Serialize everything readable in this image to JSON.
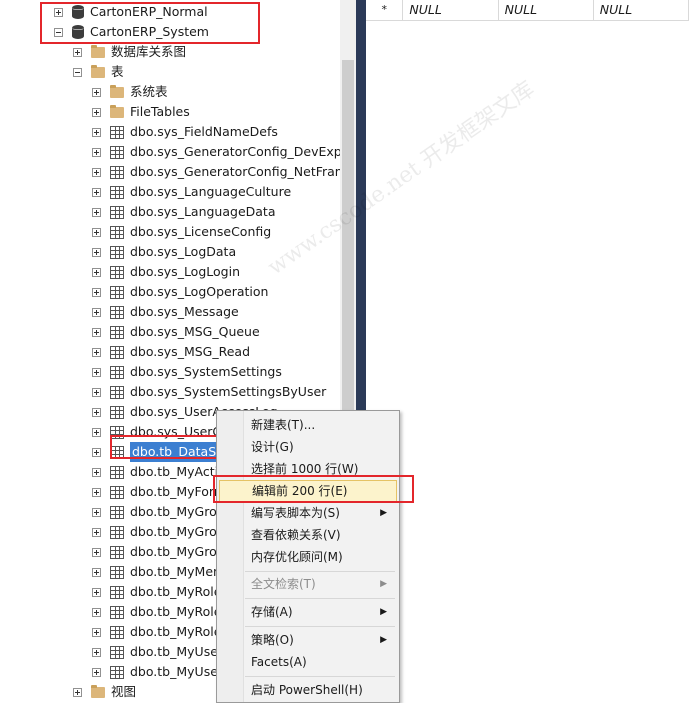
{
  "tree": {
    "databases": [
      {
        "label": "CartonERP_Normal"
      },
      {
        "label": "CartonERP_System"
      }
    ],
    "folders": {
      "diagrams": "数据库关系图",
      "tables": "表",
      "system_tables": "系统表",
      "filetables": "FileTables",
      "views": "视图"
    },
    "tables": [
      "dbo.sys_FieldNameDefs",
      "dbo.sys_GeneratorConfig_DevExpres",
      "dbo.sys_GeneratorConfig_NetFramew",
      "dbo.sys_LanguageCulture",
      "dbo.sys_LanguageData",
      "dbo.sys_LicenseConfig",
      "dbo.sys_LogData",
      "dbo.sys_LogLogin",
      "dbo.sys_LogOperation",
      "dbo.sys_Message",
      "dbo.sys_MSG_Queue",
      "dbo.sys_MSG_Read",
      "dbo.sys_SystemSettings",
      "dbo.sys_SystemSettingsByUser",
      "dbo.sys_UserAccessLog",
      "dbo.sys_UserC",
      "dbo.tb_DataSet",
      "dbo.tb_MyActio",
      "dbo.tb_MyForm",
      "dbo.tb_MyGrou",
      "dbo.tb_MyGrou",
      "dbo.tb_MyGrou",
      "dbo.tb_MyMen",
      "dbo.tb_MyRole",
      "dbo.tb_MyRole",
      "dbo.tb_MyRole",
      "dbo.tb_MyUser",
      "dbo.tb_MyUser"
    ]
  },
  "grid": {
    "row_marker": "*",
    "cells": [
      "NULL",
      "NULL",
      "NULL"
    ]
  },
  "context_menu": {
    "new_table": "新建表(T)...",
    "design": "设计(G)",
    "select_top": "选择前 1000 行(W)",
    "edit_top": "编辑前 200 行(E)",
    "script_as": "编写表脚本为(S)",
    "view_dependencies": "查看依赖关系(V)",
    "memory_advisor": "内存优化顾问(M)",
    "fulltext": "全文检索(T)",
    "storage": "存储(A)",
    "policies": "策略(O)",
    "facets": "Facets(A)",
    "powershell": "启动 PowerShell(H)"
  },
  "watermark": "www.cscode.net 开发框架文库",
  "colors": {
    "highlight_box": "#e3262b",
    "selection": "#3c7fd1",
    "menu_hover": "#fcf3cc"
  }
}
